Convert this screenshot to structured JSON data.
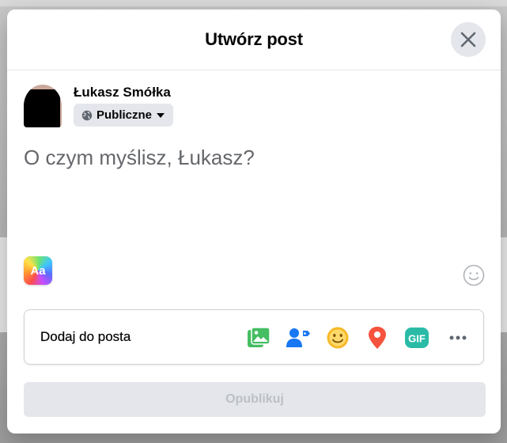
{
  "dialog": {
    "title": "Utwórz post"
  },
  "user": {
    "name": "Łukasz Smółka",
    "audience_label": "Publiczne"
  },
  "composer": {
    "placeholder": "O czym myślisz, Łukasz?"
  },
  "text_format": {
    "label": "Aa"
  },
  "add_to_post": {
    "label": "Dodaj do posta",
    "tools": [
      {
        "icon": "photo-video-icon",
        "color": "#45bd62"
      },
      {
        "icon": "tag-people-icon",
        "color": "#1877f2"
      },
      {
        "icon": "feeling-activity-icon",
        "color": "#f7b928"
      },
      {
        "icon": "check-in-icon",
        "color": "#f5533d"
      },
      {
        "icon": "gif-icon",
        "color": "#2abba7",
        "label": "GIF"
      },
      {
        "icon": "more-icon",
        "color": "#606770"
      }
    ]
  },
  "publish": {
    "label": "Opublikuj"
  },
  "colors": {
    "modal_bg": "#ffffff",
    "button_grey": "#e4e6eb",
    "disabled_text": "#bcc0c4",
    "placeholder_text": "#65676b"
  }
}
